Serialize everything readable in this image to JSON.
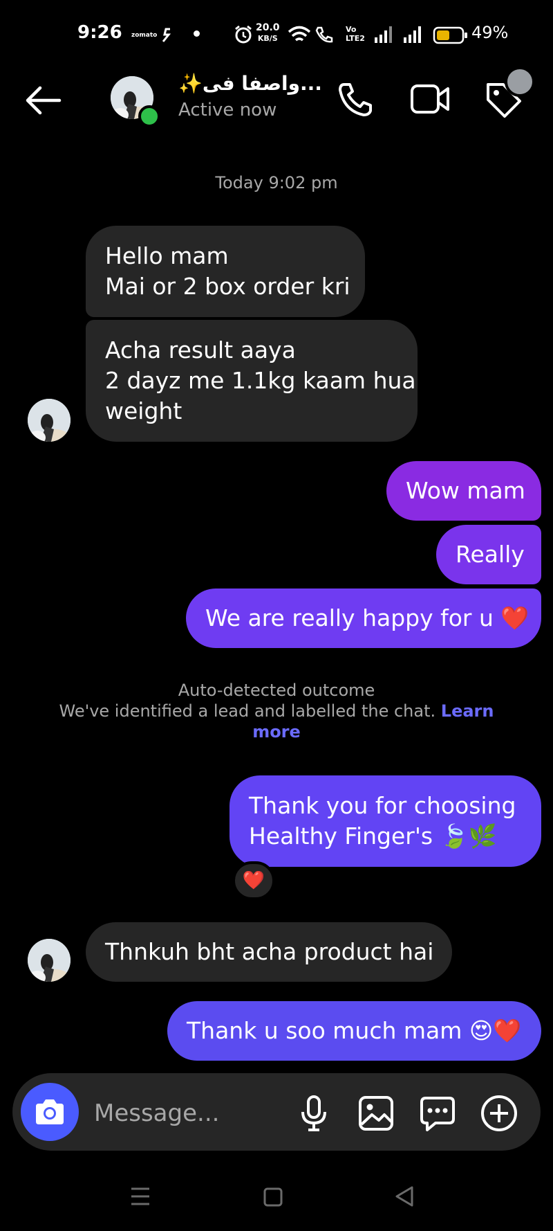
{
  "status_bar": {
    "time": "9:26",
    "app_label": "zomato",
    "speed_value": "20.0",
    "speed_unit": "KB/S",
    "volte": "Vo",
    "lte": "LTE2",
    "battery_percent": "49%"
  },
  "header": {
    "contact_name": "✨واصفا فی...",
    "status": "Active now",
    "online_color": "#2ec04a"
  },
  "chat": {
    "timestamp": "Today 9:02 pm",
    "messages": [
      {
        "from": "them",
        "lines": [
          "Hello mam",
          "Mai or 2 box order kri"
        ]
      },
      {
        "from": "them",
        "lines": [
          "Acha result aaya",
          "2 dayz me 1.1kg kaam hua",
          "weight"
        ]
      },
      {
        "from": "me",
        "lines": [
          "Wow mam"
        ]
      },
      {
        "from": "me",
        "lines": [
          "Really"
        ]
      },
      {
        "from": "me",
        "lines": [
          "We are really happy for u ❤️"
        ]
      },
      {
        "from": "me",
        "lines": [
          "Thank you for choosing",
          "Healthy Finger's 🍃🌿"
        ]
      },
      {
        "from": "them",
        "lines": [
          "Thnkuh bht acha product hai"
        ]
      },
      {
        "from": "me",
        "lines": [
          "Thank u soo much mam 😍❤️"
        ]
      }
    ],
    "reaction": "❤️",
    "notice": {
      "title": "Auto-detected outcome",
      "body": "We've identified a lead and labelled the chat.",
      "link_part1": "Learn",
      "link_part2": "more"
    }
  },
  "composer": {
    "placeholder": "Message..."
  },
  "colors": {
    "background": "#000000",
    "incoming_bubble": "#262626",
    "outgoing_purple": "#8a2be2",
    "outgoing_violet": "#6f3cf2",
    "outgoing_blue": "#5b4cf0",
    "accent_blue": "#4a5bff",
    "link": "#6b6bff"
  },
  "icons": [
    "back-arrow-icon",
    "phone-icon",
    "video-camera-icon",
    "tag-icon",
    "camera-icon",
    "microphone-icon",
    "gallery-icon",
    "sticker-chat-icon",
    "plus-circle-icon",
    "nav-menu-icon",
    "nav-home-icon",
    "nav-back-icon"
  ]
}
